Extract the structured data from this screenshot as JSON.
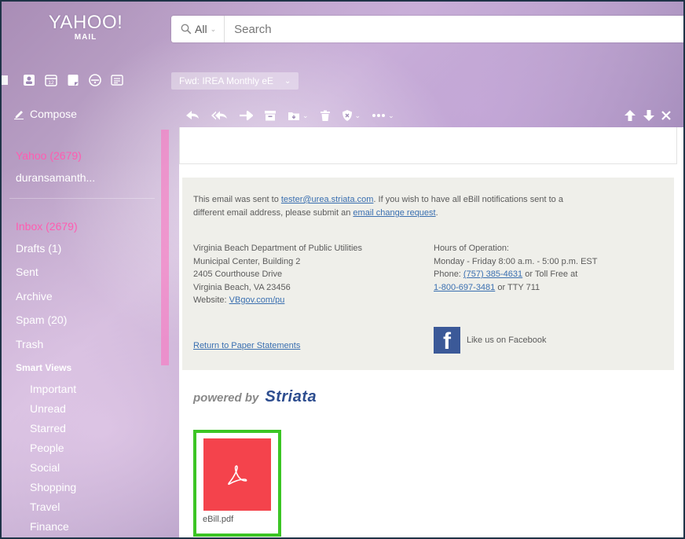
{
  "brand": {
    "logo_main": "YAHOO!",
    "logo_sub": "MAIL"
  },
  "search": {
    "scope_label": "All",
    "placeholder": "Search"
  },
  "app_icons": [
    "mail-icon",
    "contacts-icon",
    "calendar-icon",
    "notepad-icon",
    "messenger-icon",
    "newsfeed-icon"
  ],
  "tab": {
    "label": "Fwd: IREA Monthly eE"
  },
  "compose": {
    "label": "Compose"
  },
  "sidebar": {
    "account_label": "Yahoo  (2679)",
    "email_label": "duransamanth...",
    "folders": [
      {
        "label": "Inbox (2679)",
        "active": true
      },
      {
        "label": "Drafts (1)",
        "active": false
      },
      {
        "label": "Sent",
        "active": false
      },
      {
        "label": "Archive",
        "active": false
      },
      {
        "label": "Spam (20)",
        "active": false
      },
      {
        "label": "Trash",
        "active": false
      }
    ],
    "smart_views_label": "Smart Views",
    "smart_views": [
      "Important",
      "Unread",
      "Starred",
      "People",
      "Social",
      "Shopping",
      "Travel",
      "Finance"
    ]
  },
  "message": {
    "notice_line1_pre": "This email was sent to ",
    "notice_email": "tester@urea.striata.com",
    "notice_line1_post": ". If you wish to have all eBill notifications sent to a",
    "notice_line2_pre": "different email address, please submit an ",
    "notice_change_link": "email change request",
    "notice_line2_post": ".",
    "address": [
      "Virginia Beach Department of Public Utilities",
      "Municipal Center, Building 2",
      "2405 Courthouse Drive",
      "Virginia Beach, VA 23456"
    ],
    "website_label": "Website: ",
    "website_link": "VBgov.com/pu",
    "return_link": "Return to Paper Statements",
    "hours": [
      "Hours of Operation:",
      "Monday - Friday 8:00 a.m. - 5:00 p.m. EST"
    ],
    "phone_label": "Phone: ",
    "phone_link": "(757) 385-4631",
    "tollfree_label": " or Toll Free at",
    "tollfree_link": "1-800-697-3481",
    "tty_label": " or TTY 711",
    "facebook_text": "Like us on Facebook",
    "powered_by_label": "powered by",
    "powered_brand": "Striata",
    "attachment_name": "eBill.pdf"
  },
  "colors": {
    "accent_pink": "#ff5cb0",
    "pdf_red": "#f4434c",
    "highlight_green": "#3cc524",
    "facebook_blue": "#3b5998",
    "striata_blue": "#2d4d8f"
  }
}
